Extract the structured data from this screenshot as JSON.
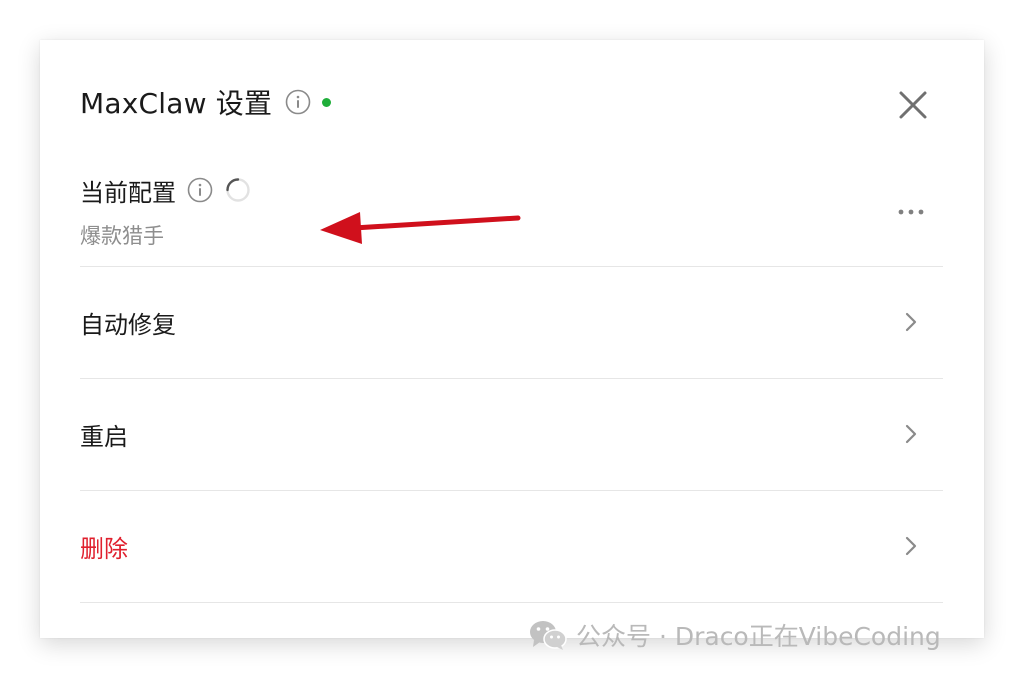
{
  "dialog": {
    "title": "MaxClaw 设置",
    "status_color": "#1fae3a"
  },
  "config": {
    "label": "当前配置",
    "current_value": "爆款猎手"
  },
  "menu": {
    "items": [
      {
        "label": "自动修复",
        "color": "#1a1a1a"
      },
      {
        "label": "重启",
        "color": "#1a1a1a"
      },
      {
        "label": "删除",
        "color": "#e0202e"
      }
    ]
  },
  "annotation": {
    "arrow_color": "#d0101c"
  },
  "watermark": {
    "text": "公众号 · Draco正在VibeCoding"
  },
  "icons": {
    "title_info": "info-icon",
    "close": "close-icon",
    "config_info": "info-icon",
    "loading": "loading-spinner-icon",
    "more": "more-horizontal-icon",
    "chevron": "chevron-right-icon",
    "wechat": "wechat-icon"
  }
}
